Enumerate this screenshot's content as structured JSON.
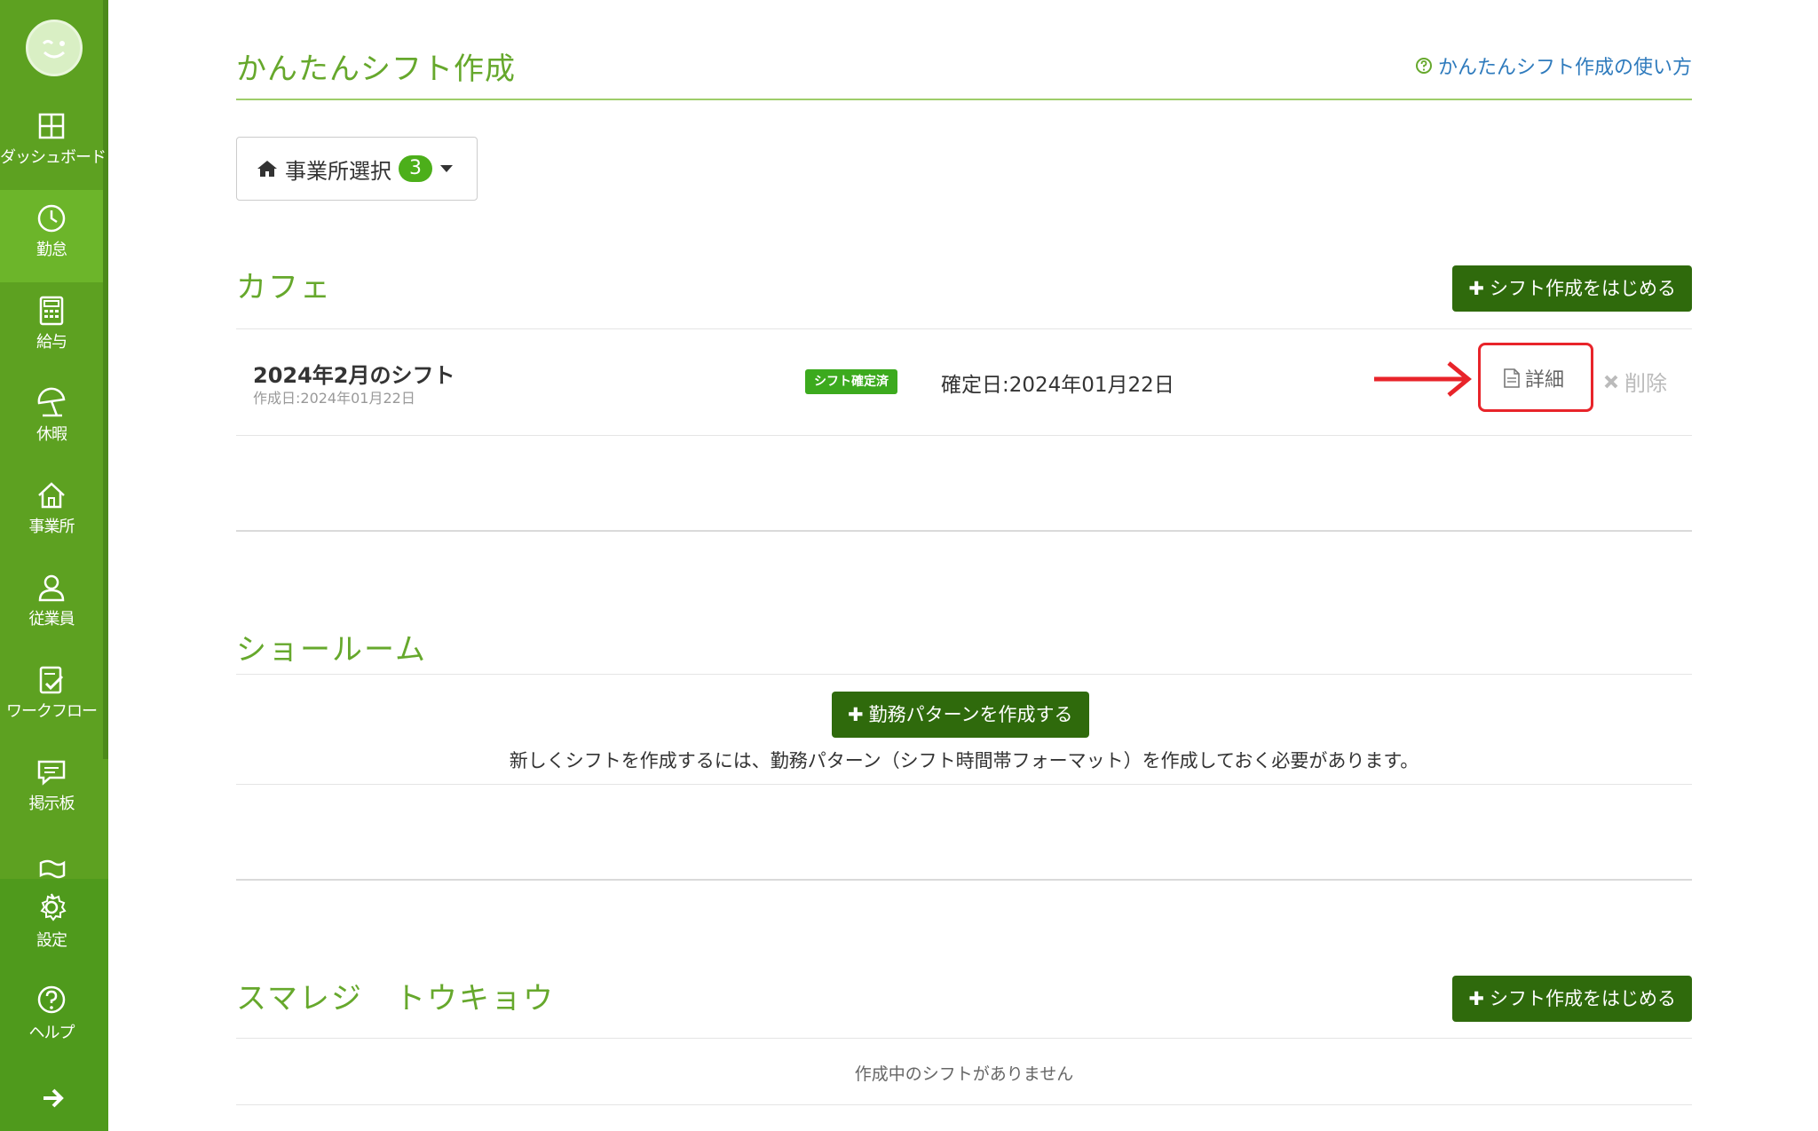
{
  "sidebar": {
    "items": [
      {
        "label": "ダッシュボード",
        "icon": "dashboard-grid-icon"
      },
      {
        "label": "勤怠",
        "icon": "clock-icon"
      },
      {
        "label": "給与",
        "icon": "calculator-icon"
      },
      {
        "label": "休暇",
        "icon": "beach-umbrella-icon"
      },
      {
        "label": "事業所",
        "icon": "house-icon"
      },
      {
        "label": "従業員",
        "icon": "person-icon"
      },
      {
        "label": "ワークフロー",
        "icon": "checklist-icon"
      },
      {
        "label": "掲示板",
        "icon": "chat-bubble-icon"
      },
      {
        "label": "",
        "icon": "flag-icon"
      },
      {
        "label": "設定",
        "icon": "gear-icon"
      },
      {
        "label": "ヘルプ",
        "icon": "question-circle-icon"
      }
    ],
    "expand_icon": "arrow-right-icon"
  },
  "header": {
    "title": "かんたんシフト作成",
    "help_link": "かんたんシフト作成の使い方"
  },
  "office_select": {
    "label": "事業所選択",
    "count": "3"
  },
  "sections": [
    {
      "name": "カフェ",
      "start_button": "シフト作成をはじめる",
      "shift": {
        "name": "2024年2月のシフト",
        "created": "作成日:2024年01月22日",
        "status": "シフト確定済",
        "confirmed": "確定日:2024年01月22日",
        "detail_label": "詳細",
        "delete_label": "削除"
      }
    },
    {
      "name": "ショールーム",
      "pattern_button": "勤務パターンを作成する",
      "notice": "新しくシフトを作成するには、勤務パターン（シフト時間帯フォーマット）を作成しておく必要があります。"
    },
    {
      "name": "スマレジ　トウキョウ",
      "start_button": "シフト作成をはじめる",
      "empty": "作成中のシフトがありません"
    }
  ],
  "colors": {
    "sidebar_bg": "#5da121",
    "accent_green": "#66a82c",
    "button_dark": "#2f6a0c",
    "badge_green": "#3caa1e",
    "link_blue": "#2f7bbd",
    "annotation_red": "#e8242a"
  }
}
